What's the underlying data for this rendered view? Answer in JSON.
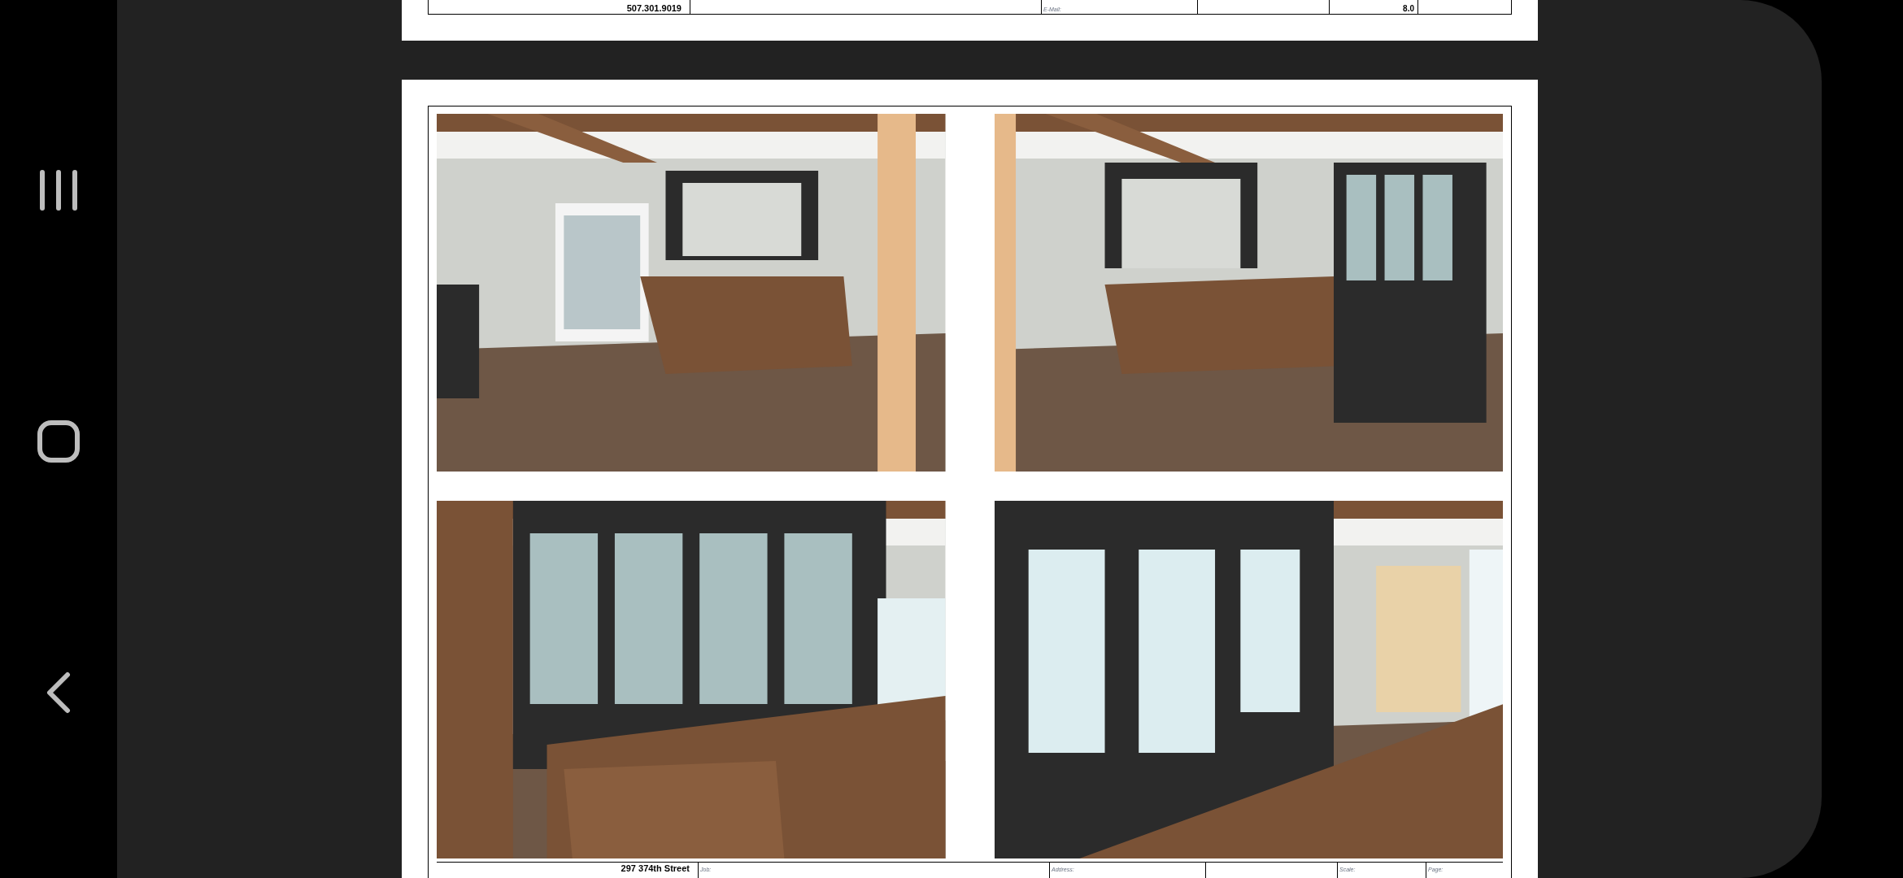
{
  "navigation_bar": {
    "buttons": [
      {
        "kind": "recents"
      },
      {
        "kind": "home"
      },
      {
        "kind": "back"
      }
    ]
  },
  "previous_page": {
    "title_block": {
      "phone": "507.301.9019",
      "email_label": "E-Mail:",
      "value": "8.0"
    }
  },
  "current_page": {
    "title_block": {
      "street": "297 374th Street",
      "job_label": "Job:",
      "address_label": "Address:",
      "scale_label": "Scale:",
      "page_label": "Page:"
    }
  }
}
